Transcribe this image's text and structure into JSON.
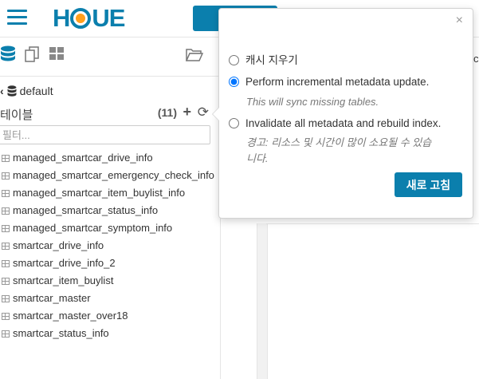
{
  "header": {
    "logo_text": "HUE",
    "menu_icon": "hamburger-icon",
    "accent_color": "#0B7FAD"
  },
  "left_panel": {
    "icons": [
      "database-icon",
      "documents-icon",
      "grid-icon",
      "folder-open-icon"
    ],
    "breadcrumb": {
      "back_icon": "chevron-left-icon",
      "db_icon": "database-icon",
      "db_name": "default"
    },
    "tables_label": "테이블",
    "table_count": "(11)",
    "add_icon": "plus-icon",
    "refresh_icon": "refresh-icon",
    "filter_placeholder": "필터...",
    "tables": [
      "managed_smartcar_drive_info",
      "managed_smartcar_emergency_check_info",
      "managed_smartcar_item_buylist_info",
      "managed_smartcar_status_info",
      "managed_smartcar_symptom_info",
      "smartcar_drive_info",
      "smartcar_drive_info_2",
      "smartcar_item_buylist",
      "smartcar_master",
      "smartcar_master_over18",
      "smartcar_status_info"
    ]
  },
  "right_panel": {
    "peek_text": "c"
  },
  "popover": {
    "close_label": "×",
    "options": [
      {
        "label": "캐시 지우기",
        "checked": false
      },
      {
        "label": "Perform incremental metadata update.",
        "checked": true,
        "hint": "This will sync missing tables."
      },
      {
        "label": "Invalidate all metadata and rebuild index.",
        "checked": false,
        "hint_line1": "경고: 리소스 및 시간이 많이 소요될 수 있습",
        "hint_line2": "니다."
      }
    ],
    "refresh_button": "새로 고침"
  }
}
